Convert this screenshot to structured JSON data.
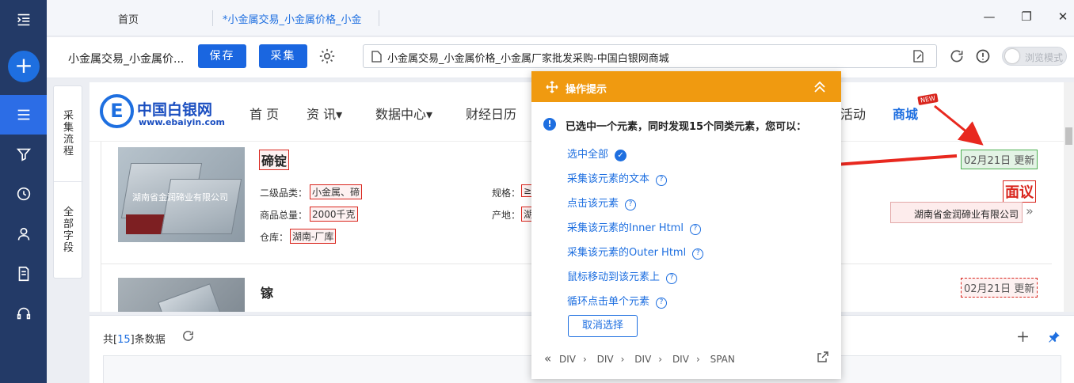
{
  "tabs": [
    {
      "label": "首页"
    },
    {
      "label": "*小金属交易_小金属价格_小金"
    }
  ],
  "toolbar": {
    "task_title": "小金属交易_小金属价...",
    "save_label": "保存",
    "collect_label": "采集",
    "url": "小金属交易_小金属价格_小金属厂家批发采购-中国白银网商城",
    "browse_mode_label": "浏览模式"
  },
  "side_tabs": [
    "采集流程",
    "全部字段"
  ],
  "site": {
    "logo_cn": "中国白银网",
    "logo_en": "www.ebaiyin.com",
    "nav": [
      "首 页",
      "资 讯▾",
      "数据中心▾",
      "财经日历",
      "活动",
      "商城"
    ],
    "new_badge": "NEW"
  },
  "products": [
    {
      "name": "碲锭",
      "image_watermark": "湖南省金润碲业有限公司",
      "secondary_category_label": "二级品类：",
      "secondary_category": "小金属、碲",
      "total_label": "商品总量：",
      "total": "2000千克",
      "warehouse_label": "仓库：",
      "warehouse": "湖南-厂库",
      "spec_label": "规格：",
      "spec_value": "≥",
      "origin_label": "产地：",
      "origin_value": "湖",
      "date": "02月21日 更新",
      "price": "面议",
      "supplier": "湖南省金润碲业有限公司"
    },
    {
      "name": "镓",
      "date": "02月21日 更新"
    }
  ],
  "bottom": {
    "count_prefix": "共[",
    "count": "15",
    "count_suffix": "]条数据"
  },
  "tip_panel": {
    "title": "操作提示",
    "message": "已选中一个元素，同时发现15个同类元素，您可以：",
    "options": [
      "选中全部",
      "采集该元素的文本",
      "点击该元素",
      "采集该元素的Inner Html",
      "采集该元素的Outer Html",
      "鼠标移动到该元素上",
      "循环点击单个元素"
    ],
    "cancel_label": "取消选择",
    "breadcrumb": [
      "DIV",
      "DIV",
      "DIV",
      "DIV",
      "SPAN"
    ]
  },
  "colors": {
    "rail": "#233a67",
    "accent": "#1e6fe0",
    "tip_header": "#f09a10",
    "highlight_red": "#d9251d",
    "selected_green": "#4caf50"
  }
}
